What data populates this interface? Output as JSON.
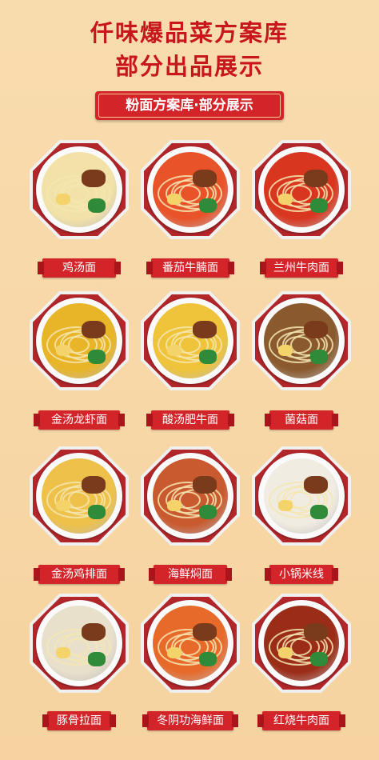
{
  "header": {
    "title_line1": "仟味爆品菜方案库",
    "title_line2": "部分出品展示"
  },
  "section": {
    "ribbon": "粉面方案库·部分展示"
  },
  "dishes": [
    {
      "name": "鸡汤面",
      "soup": "#f3e2a8"
    },
    {
      "name": "番茄牛腩面",
      "soup": "#e8532a"
    },
    {
      "name": "兰州牛肉面",
      "soup": "#d9361f"
    },
    {
      "name": "金汤龙虾面",
      "soup": "#e8b528"
    },
    {
      "name": "酸汤肥牛面",
      "soup": "#efc43a"
    },
    {
      "name": "菌菇面",
      "soup": "#8a5a2e"
    },
    {
      "name": "金汤鸡排面",
      "soup": "#eec14b"
    },
    {
      "name": "海鲜焖面",
      "soup": "#c9592e"
    },
    {
      "name": "小锅米线",
      "soup": "#f1ece2"
    },
    {
      "name": "豚骨拉面",
      "soup": "#e9e0cc"
    },
    {
      "name": "冬阴功海鲜面",
      "soup": "#e76a2a"
    },
    {
      "name": "红烧牛肉面",
      "soup": "#9b2c17"
    }
  ]
}
